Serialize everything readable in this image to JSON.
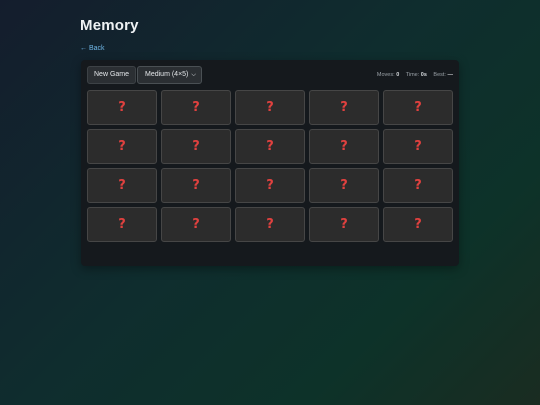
{
  "page": {
    "title": "Memory",
    "back_label": "← Back"
  },
  "toolbar": {
    "new_game_label": "New Game",
    "difficulty": {
      "selected": "Medium (4×5)",
      "icon": "chevron-down-icon"
    }
  },
  "stats": {
    "moves_label": "Moves:",
    "moves_value": "0",
    "time_label": "Time:",
    "time_value": "0s",
    "best_label": "Best:",
    "best_value": "—"
  },
  "board": {
    "rows": 4,
    "columns": 5,
    "cards": [
      {
        "face": "?",
        "revealed": false
      },
      {
        "face": "?",
        "revealed": false
      },
      {
        "face": "?",
        "revealed": false
      },
      {
        "face": "?",
        "revealed": false
      },
      {
        "face": "?",
        "revealed": false
      },
      {
        "face": "?",
        "revealed": false
      },
      {
        "face": "?",
        "revealed": false
      },
      {
        "face": "?",
        "revealed": false
      },
      {
        "face": "?",
        "revealed": false
      },
      {
        "face": "?",
        "revealed": false
      },
      {
        "face": "?",
        "revealed": false
      },
      {
        "face": "?",
        "revealed": false
      },
      {
        "face": "?",
        "revealed": false
      },
      {
        "face": "?",
        "revealed": false
      },
      {
        "face": "?",
        "revealed": false
      },
      {
        "face": "?",
        "revealed": false
      },
      {
        "face": "?",
        "revealed": false
      },
      {
        "face": "?",
        "revealed": false
      },
      {
        "face": "?",
        "revealed": false
      },
      {
        "face": "?",
        "revealed": false
      }
    ]
  },
  "colors": {
    "card_mark": "#e0413f",
    "link": "#6fb6e6",
    "panel": "#15191d"
  }
}
